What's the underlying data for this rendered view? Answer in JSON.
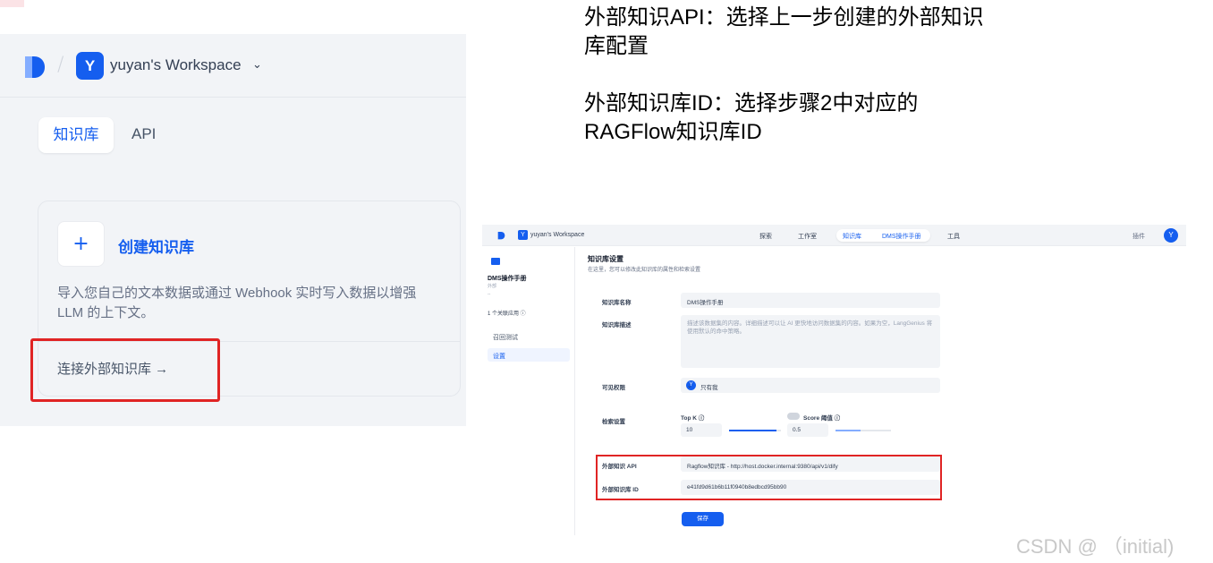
{
  "left_panel": {
    "workspace_initial": "Y",
    "workspace_name": "yuyan's Workspace",
    "tabs": [
      "知识库",
      "API"
    ],
    "create_card": {
      "plus": "+",
      "title": "创建知识库",
      "description": "导入您自己的文本数据或通过 Webhook 实时写入数据以增强 LLM 的上下文。",
      "connect_label": "连接外部知识库 →"
    }
  },
  "annotations": [
    "外部知识API：选择上一步创建的外部知识库配置",
    "外部知识库ID：选择步骤2中对应的RAGFlow知识库ID"
  ],
  "settings_screen": {
    "workspace_initial": "Y",
    "workspace_name": "yuyan's Workspace",
    "nav": [
      "探索",
      "工作室",
      "知识库",
      "DMS操作手册",
      "工具"
    ],
    "plugins_label": "插件",
    "user_initial": "Y",
    "sidebar": {
      "kb_name": "DMS操作手册",
      "kb_type": "外部",
      "kb_desc": "--",
      "linked_apps": "1 个关联应用 ⓘ",
      "items": [
        "召回测试",
        "设置"
      ]
    },
    "page_title": "知识库设置",
    "page_subtitle": "在这里，您可以修改此知识库的属性和检索设置",
    "fields": {
      "name_label": "知识库名称",
      "name_value": "DMS操作手册",
      "desc_label": "知识库描述",
      "desc_placeholder": "描述该数据集的内容。详细描述可以让 AI 更快地访问数据集的内容。如果为空，LangGenius 将使用默认的命中策略。",
      "visibility_label": "可见权限",
      "visibility_value": "只有我",
      "retrieval_label": "检索设置",
      "topk_label": "Top K ⓘ",
      "topk_value": "10",
      "score_label": "Score 阈值 ⓘ",
      "score_value": "0.5",
      "ext_api_label": "外部知识 API",
      "ext_api_value": "Ragflow知识库 - http://host.docker.internal:9380/api/v1/dify",
      "ext_id_label": "外部知识库 ID",
      "ext_id_value": "e41fd9d61b6b11f0940b8edbcd95bb90"
    },
    "save_label": "保存"
  },
  "watermark": "CSDN @ （initial)"
}
